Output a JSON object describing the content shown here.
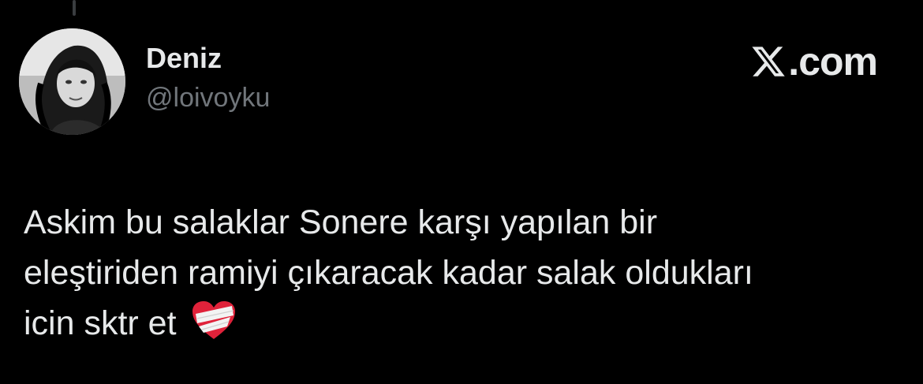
{
  "tweet": {
    "author": {
      "display_name": "Deniz",
      "handle": "@loivoyku"
    },
    "brand": {
      "label": ".com",
      "logo_icon": "x-logo-icon"
    },
    "text_lines": [
      "Askim bu salaklar Sonere karşı yapılan bir",
      "eleştiriden ramiyi çıkaracak kadar salak oldukları",
      "icin sktr et"
    ],
    "emoji_icon": "mending-heart-icon"
  },
  "colors": {
    "background": "#000000",
    "primary_text": "#e7e9ea",
    "secondary_text": "#71767b",
    "heart": "#e0223a",
    "bandage": "#f3f3f3"
  }
}
